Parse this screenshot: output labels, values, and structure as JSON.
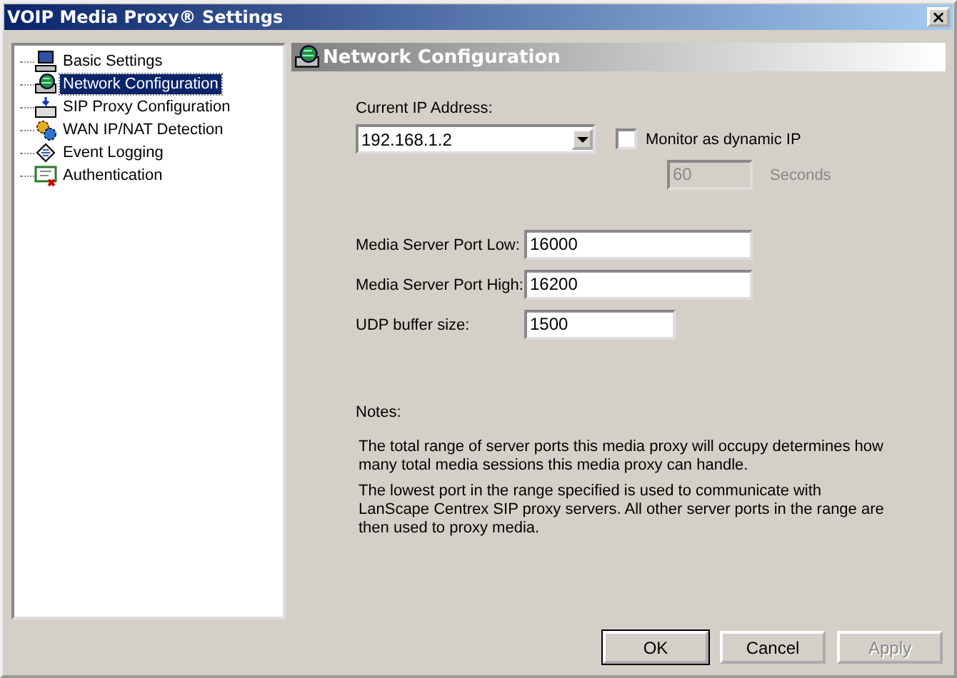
{
  "window": {
    "title": "VOIP Media Proxy® Settings",
    "close": "×"
  },
  "sidebar": {
    "items": [
      {
        "label": "Basic Settings",
        "kind": "computer",
        "selected": false
      },
      {
        "label": "Network Configuration",
        "kind": "network",
        "selected": true
      },
      {
        "label": "SIP Proxy Configuration",
        "kind": "sip",
        "selected": false
      },
      {
        "label": "WAN IP/NAT Detection",
        "kind": "gears",
        "selected": false
      },
      {
        "label": "Event Logging",
        "kind": "log",
        "selected": false
      },
      {
        "label": "Authentication",
        "kind": "auth",
        "selected": false
      }
    ]
  },
  "panel": {
    "title": "Network Configuration",
    "ip_label": "Current IP Address:",
    "ip_value": "192.168.1.2",
    "dynamic": {
      "label": "Monitor as dynamic IP",
      "checked": false
    },
    "interval": {
      "value": "60",
      "unit": "Seconds",
      "disabled": true
    },
    "fields": [
      {
        "label": "Media Server Port Low:",
        "value": "16000",
        "kind": "wide"
      },
      {
        "label": "Media Server Port High:",
        "value": "16200",
        "kind": "wide"
      },
      {
        "label": "UDP buffer size:",
        "value": "1500",
        "kind": "short"
      }
    ],
    "notes_label": "Notes:",
    "notes": [
      "The total range of server ports this media proxy will occupy determines how many total media sessions this media proxy can handle.",
      "The lowest port in the range specified is used to communicate with LanScape Centrex SIP proxy servers. All  other server ports in the range are then used to proxy media."
    ]
  },
  "buttons": [
    {
      "label": "OK",
      "default": true,
      "disabled": false
    },
    {
      "label": "Cancel",
      "default": false,
      "disabled": false
    },
    {
      "label": "Apply",
      "default": false,
      "disabled": true
    }
  ]
}
